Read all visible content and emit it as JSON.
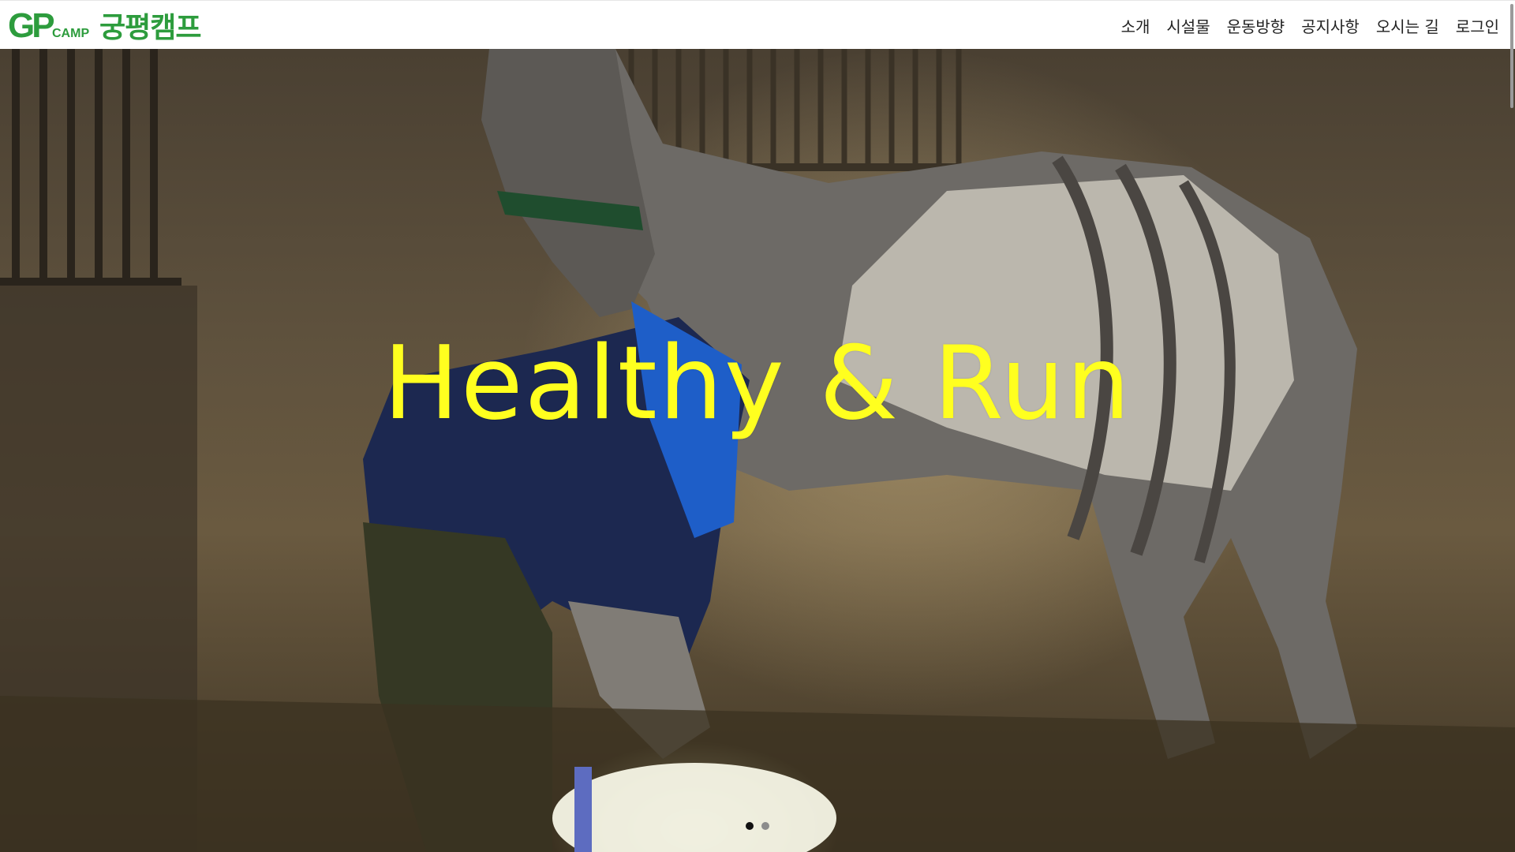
{
  "header": {
    "logo": {
      "mark_text": "GP",
      "mark_sub": "CAMP",
      "name": "궁평캠프"
    },
    "nav": [
      "소개",
      "시설물",
      "운동방향",
      "공지사항",
      "오시는 길",
      "로그인"
    ]
  },
  "hero": {
    "title": "Healthy & Run",
    "slides": {
      "count": 2,
      "active_index": 0
    }
  },
  "colors": {
    "brand": "#2d9c3d",
    "hero_title": "#ffff1f",
    "dot_active": "#111111",
    "dot_inactive": "#8c8c8c"
  }
}
